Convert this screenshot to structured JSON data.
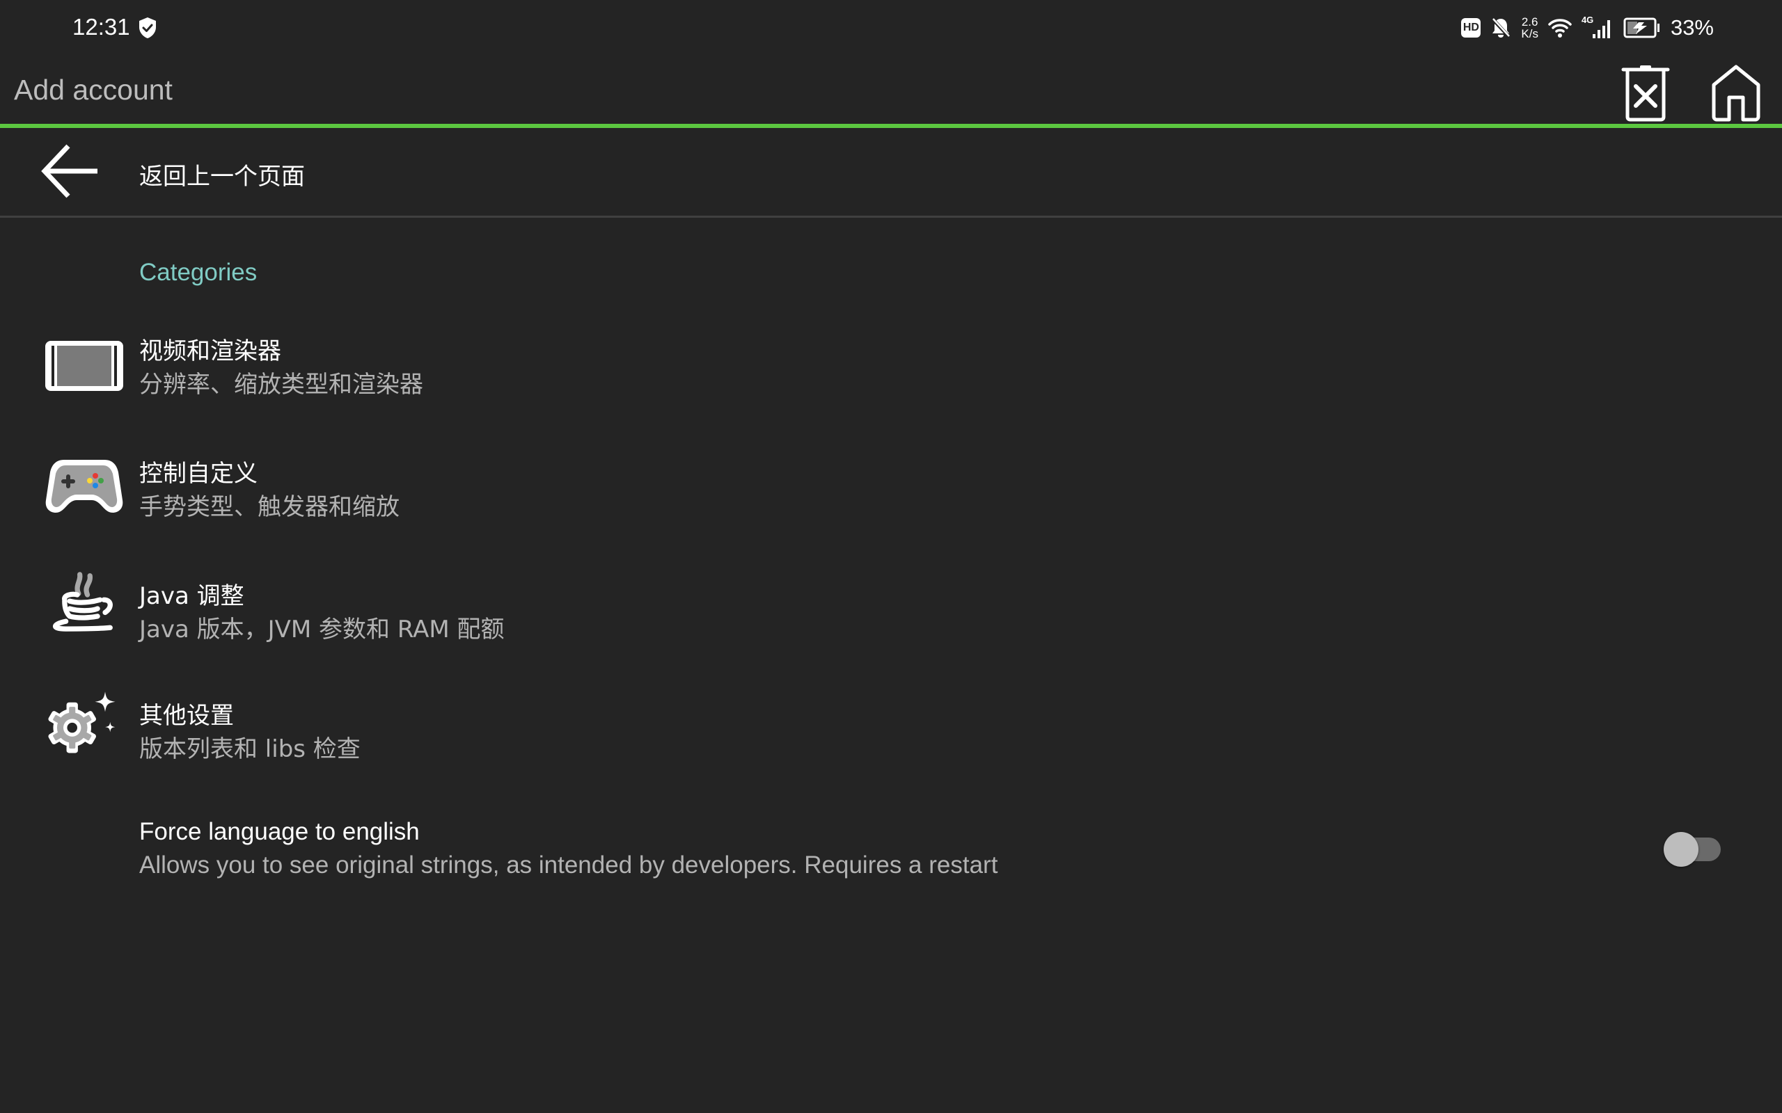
{
  "status_bar": {
    "time": "12:31",
    "hd": "HD",
    "speed_value": "2.6",
    "speed_unit": "K/s",
    "network": "4G",
    "battery": "33%",
    "icons": [
      "shield-check-icon",
      "hd-icon",
      "bell-off-icon",
      "wifi-icon",
      "cellular-signal-icon",
      "battery-charging-icon"
    ]
  },
  "app_bar": {
    "title": "Add account",
    "actions": [
      "delete-icon",
      "home-icon"
    ],
    "accent_color": "#5cc740"
  },
  "back_row": {
    "label": "返回上一个页面",
    "icon": "arrow-left-icon"
  },
  "settings": {
    "category_header": "Categories",
    "category_color": "#80cbc4",
    "items": [
      {
        "title": "视频和渲染器",
        "subtitle": "分辨率、缩放类型和渲染器",
        "icon": "video-screen-icon"
      },
      {
        "title": "控制自定义",
        "subtitle": "手势类型、触发器和缩放",
        "icon": "gamepad-icon"
      },
      {
        "title": "Java 调整",
        "subtitle": "Java 版本，JVM 参数和 RAM 配额",
        "icon": "java-cup-icon"
      },
      {
        "title": "其他设置",
        "subtitle": "版本列表和 libs 检查",
        "icon": "gear-sparkle-icon"
      }
    ],
    "switch_item": {
      "title": "Force language to english",
      "subtitle": "Allows you to see original strings, as intended by developers. Requires a restart",
      "checked": false
    }
  }
}
